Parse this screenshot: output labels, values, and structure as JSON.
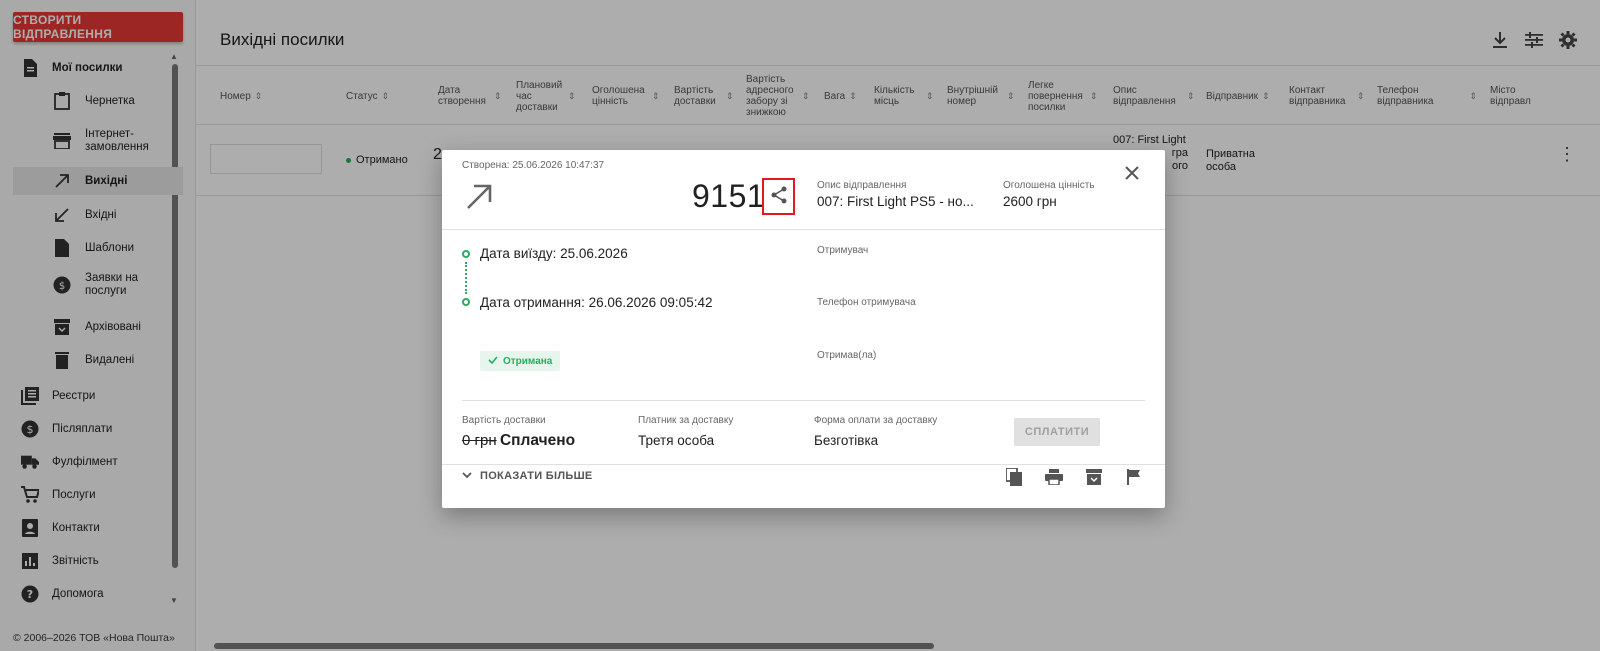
{
  "sidebar": {
    "create_button": "СТВОРИТИ ВІДПРАВЛЕННЯ",
    "items": [
      {
        "label": "Мої посилки",
        "icon": "document-icon"
      },
      {
        "label": "Чернетка",
        "icon": "clipboard-icon"
      },
      {
        "label": "Інтернет-\nзамовлення",
        "icon": "store-icon"
      },
      {
        "label": "Вихідні",
        "icon": "arrow-outgoing-icon"
      },
      {
        "label": "Вхідні",
        "icon": "arrow-incoming-icon"
      },
      {
        "label": "Шаблони",
        "icon": "file-icon"
      },
      {
        "label": "Заявки на\nпослуги",
        "icon": "service-request-icon"
      },
      {
        "label": "Архівовані",
        "icon": "archive-icon"
      },
      {
        "label": "Видалені",
        "icon": "trash-icon"
      },
      {
        "label": "Реєстри",
        "icon": "registry-icon"
      },
      {
        "label": "Післяплати",
        "icon": "dollar-icon"
      },
      {
        "label": "Фулфілмент",
        "icon": "truck-icon"
      },
      {
        "label": "Послуги",
        "icon": "cart-icon"
      },
      {
        "label": "Контакти",
        "icon": "contacts-icon"
      },
      {
        "label": "Звітність",
        "icon": "report-icon"
      },
      {
        "label": "Допомога",
        "icon": "help-icon"
      }
    ],
    "footer": "© 2006–2026 ТОВ «Нова Пошта»"
  },
  "main": {
    "title": "Вихідні посилки",
    "columns": [
      "Номер",
      "Статус",
      "Дата створення",
      "Плановий час доставки",
      "Оголошена цінність",
      "Вартість доставки",
      "Вартість адресного забору зі знижкою",
      "Вага",
      "Кількість місць",
      "Внутрішній номер",
      "Легке повернення посилки",
      "Опис відправлення",
      "Відправник",
      "Контакт відправника",
      "Телефон відправника",
      "Місто відправл"
    ],
    "row": {
      "status": "Отримано",
      "date_partial": "2",
      "description_partial_1": "007: First Light",
      "description_partial_2": "гра",
      "description_partial_3": "ого",
      "sender": "Приватна особа"
    }
  },
  "dialog": {
    "created": "Створена: 25.06.2026 10:47:37",
    "number": "9151",
    "desc_label": "Опис відправлення",
    "desc_value": "007: First Light PS5 - но...",
    "declared_label": "Оголошена цінність",
    "declared_value": "2600 грн",
    "departure": "Дата виїзду: 25.06.2026",
    "received": "Дата отримання: 26.06.2026 09:05:42",
    "badge": "Отримана",
    "recipient_label": "Отримувач",
    "recipient_phone_label": "Телефон отримувача",
    "received_by_label": "Отримав(ла)",
    "delivery_cost_label": "Вартість доставки",
    "delivery_cost_old": "0 грн",
    "delivery_cost_status": "Сплачено",
    "payer_label": "Платник за доставку",
    "payer_value": "Третя особа",
    "payment_form_label": "Форма оплати за доставку",
    "payment_form_value": "Безготівка",
    "pay_button": "СПЛАТИТИ",
    "show_more": "ПОКАЗАТИ БІЛЬШЕ"
  },
  "colors": {
    "brand_red": "#e53935",
    "status_green": "#27ae60",
    "highlight_red": "#e3191f"
  }
}
